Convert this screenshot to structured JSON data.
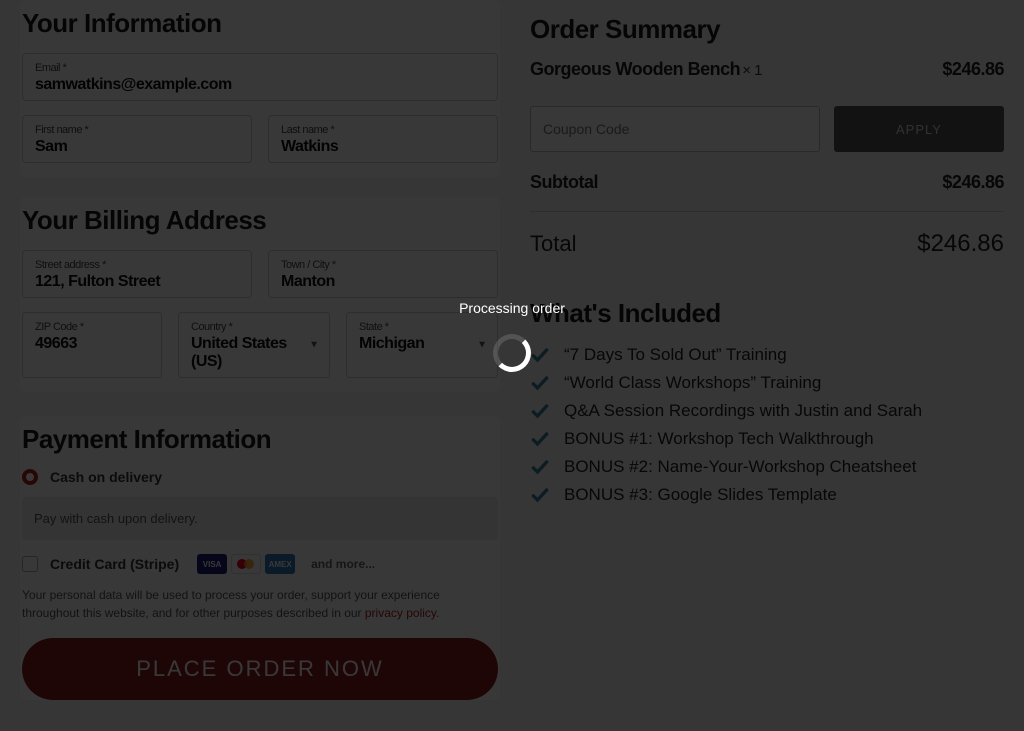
{
  "info": {
    "title": "Your Information",
    "email_label": "Email *",
    "email_value": "samwatkins@example.com",
    "first_label": "First name *",
    "first_value": "Sam",
    "last_label": "Last name *",
    "last_value": "Watkins"
  },
  "billing": {
    "title": "Your Billing Address",
    "street_label": "Street address *",
    "street_value": "121, Fulton Street",
    "city_label": "Town / City *",
    "city_value": "Manton",
    "zip_label": "ZIP Code *",
    "zip_value": "49663",
    "country_label": "Country *",
    "country_value": "United States (US)",
    "state_label": "State *",
    "state_value": "Michigan"
  },
  "payment": {
    "title": "Payment Information",
    "cod_label": "Cash on delivery",
    "cod_desc": "Pay with cash upon delivery.",
    "cc_label": "Credit Card (Stripe)",
    "more": "and more...",
    "disclaimer_pre": "Your personal data will be used to process your order, support your experience throughout this website, and for other purposes described in our ",
    "disclaimer_link": "privacy policy",
    "disclaimer_post": ".",
    "place_btn": "PLACE ORDER NOW"
  },
  "summary": {
    "title": "Order Summary",
    "product_name": "Gorgeous Wooden Bench",
    "product_qty": "× 1",
    "product_price": "$246.86",
    "coupon_placeholder": "Coupon Code",
    "apply_btn": "APPLY",
    "subtotal_label": "Subtotal",
    "subtotal_value": "$246.86",
    "total_label": "Total",
    "total_value": "$246.86"
  },
  "included": {
    "title": "What's Included",
    "items": [
      "“7 Days To Sold Out” Training",
      "“World Class Workshops” Training",
      "Q&A Session Recordings with Justin and Sarah",
      "BONUS #1: Workshop Tech Walkthrough",
      "BONUS #2: Name-Your-Workshop Cheatsheet",
      "BONUS #3: Google Slides Template"
    ]
  },
  "overlay": {
    "text": "Processing order"
  }
}
